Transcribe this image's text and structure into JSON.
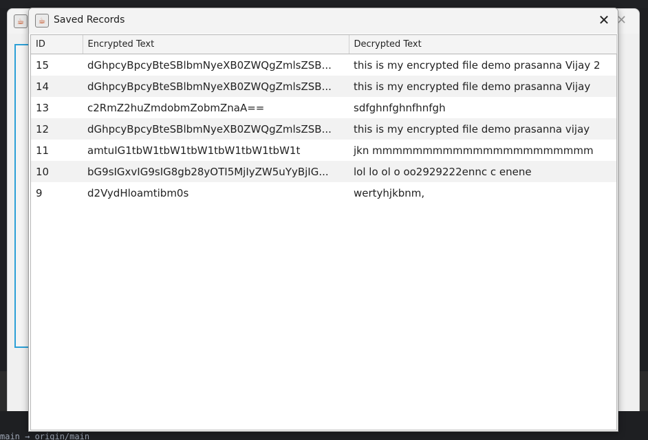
{
  "dialog": {
    "title": "Saved Records",
    "close_glyph": "✕",
    "icon": "java-icon"
  },
  "table": {
    "columns": [
      "ID",
      "Encrypted Text",
      "Decrypted Text"
    ],
    "rows": [
      {
        "id": "15",
        "encrypted": "dGhpcyBpcyBteSBlbmNyeXB0ZWQgZmlsZSB...",
        "decrypted": "this is my encrypted file demo prasanna Vijay 2"
      },
      {
        "id": "14",
        "encrypted": "dGhpcyBpcyBteSBlbmNyeXB0ZWQgZmlsZSB...",
        "decrypted": "this is my encrypted file demo prasanna Vijay"
      },
      {
        "id": "13",
        "encrypted": "c2RmZ2huZmdobmZobmZnaA==",
        "decrypted": "sdfghnfghnfhnfgh"
      },
      {
        "id": "12",
        "encrypted": "dGhpcyBpcyBteSBlbmNyeXB0ZWQgZmlsZSB...",
        "decrypted": "this is my encrypted file demo prasanna vijay"
      },
      {
        "id": "11",
        "encrypted": "amtuIG1tbW1tbW1tbW1tbW1tbW1tbW1t",
        "decrypted": "jkn mmmmmmmmmmmmmmmmmmmmmm"
      },
      {
        "id": "10",
        "encrypted": "bG9sIGxvIG9sIG8gb28yOTI5MjIyZW5uYyBjIG...",
        "decrypted": "lol lo ol o oo2929222ennc c enene"
      },
      {
        "id": "9",
        "encrypted": "d2VydHloamtibm0s",
        "decrypted": "wertyhjkbnm,"
      }
    ]
  },
  "background": {
    "close_glyph": "✕",
    "terminal_text": "main   → origin/main"
  },
  "colors": {
    "accent": "#2a9fd6",
    "row_alt": "#f2f2f2",
    "header_bg": "#f4f4f4"
  }
}
